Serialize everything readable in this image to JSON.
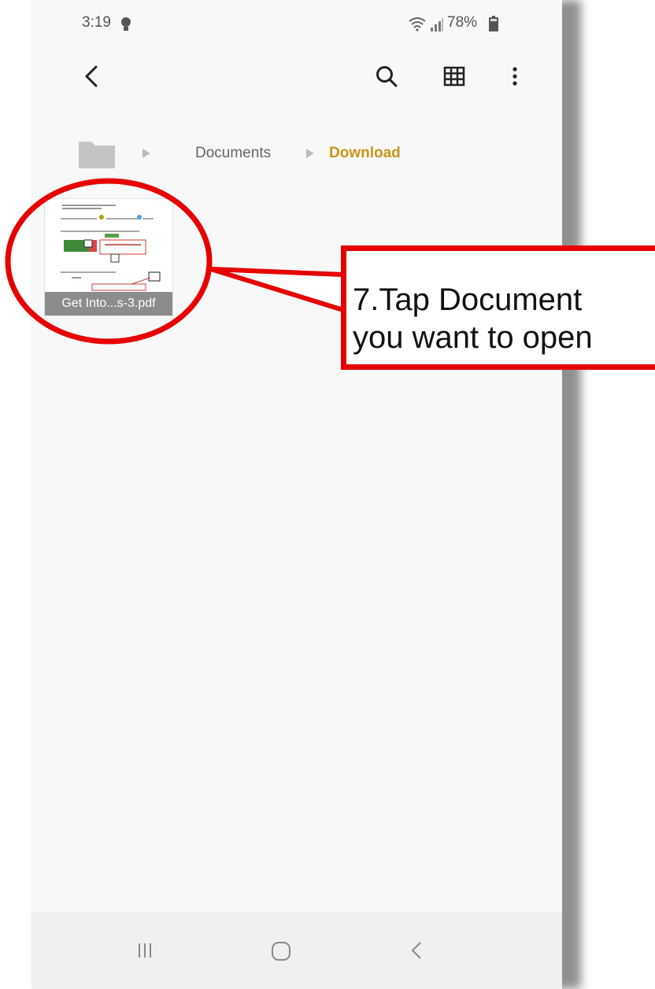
{
  "status_bar": {
    "time": "3:19",
    "battery": "78%",
    "icons": [
      "bulb-icon",
      "wifi-icon",
      "signal-icon",
      "battery-icon"
    ]
  },
  "toolbar": {
    "icons": [
      "back-icon",
      "search-icon",
      "grid-view-icon",
      "more-options-icon"
    ]
  },
  "breadcrumb": {
    "items": [
      "Documents",
      "Download"
    ],
    "current_color": "#c8951c"
  },
  "files": [
    {
      "name": "Get Into...s-3.pdf"
    }
  ],
  "annotation": {
    "text_line1": "7.Tap Document",
    "text_line2": "you want to open",
    "color": "#e60000"
  },
  "nav_bar": {
    "icons": [
      "recents-icon",
      "home-icon",
      "back-icon"
    ]
  }
}
